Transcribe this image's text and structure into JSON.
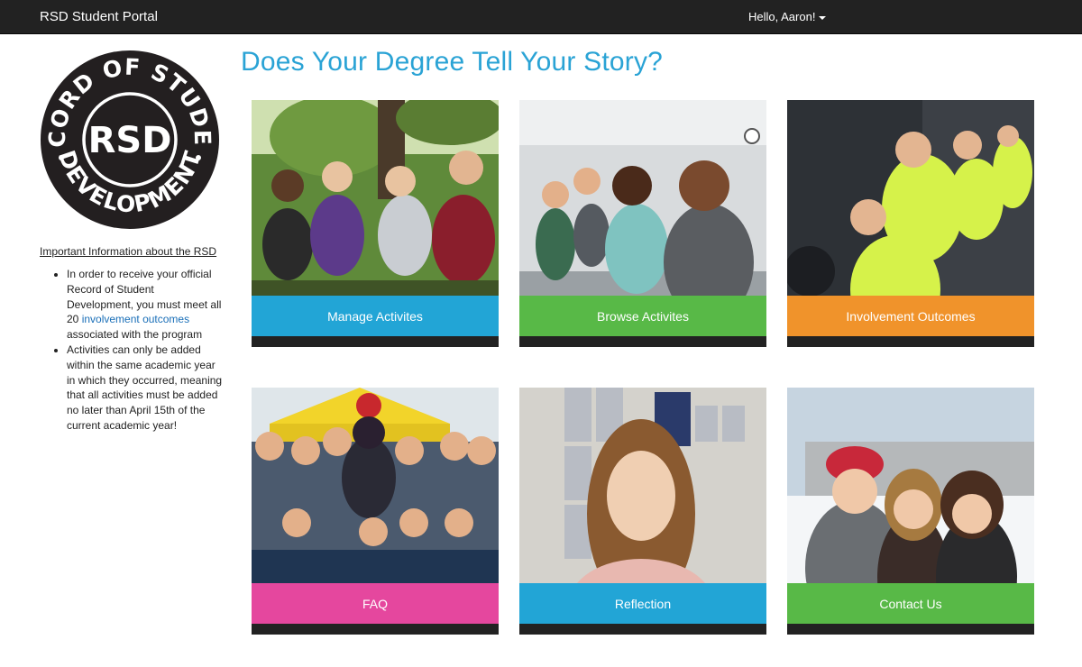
{
  "navbar": {
    "brand": "RSD Student Portal",
    "user_greeting": "Hello, Aaron!"
  },
  "logo": {
    "top_text": "RECORD OF STUDENT",
    "center_text": "RSD",
    "bottom_text": "DEVELOPMENT",
    "color": "#231f20"
  },
  "sidebar": {
    "heading": "Important Information about the RSD",
    "item1_before": "In order to receive your official Record of Student Development, you must meet all 20",
    "item1_link": "involvement outcomes",
    "item1_after": "associated with the program",
    "item2": "Activities can only be added within the same academic year in which they occurred, meaning that all activities must be added no later than April 15th of the current academic year!"
  },
  "main": {
    "title": "Does Your Degree Tell Your Story?"
  },
  "tiles": [
    {
      "label": "Manage Activites",
      "color": "#22a5d6"
    },
    {
      "label": "Browse Activites",
      "color": "#58b947"
    },
    {
      "label": "Involvement Outcomes",
      "color": "#f0932b"
    },
    {
      "label": "FAQ",
      "color": "#e5479e"
    },
    {
      "label": "Reflection",
      "color": "#22a5d6"
    },
    {
      "label": "Contact Us",
      "color": "#58b947"
    }
  ]
}
